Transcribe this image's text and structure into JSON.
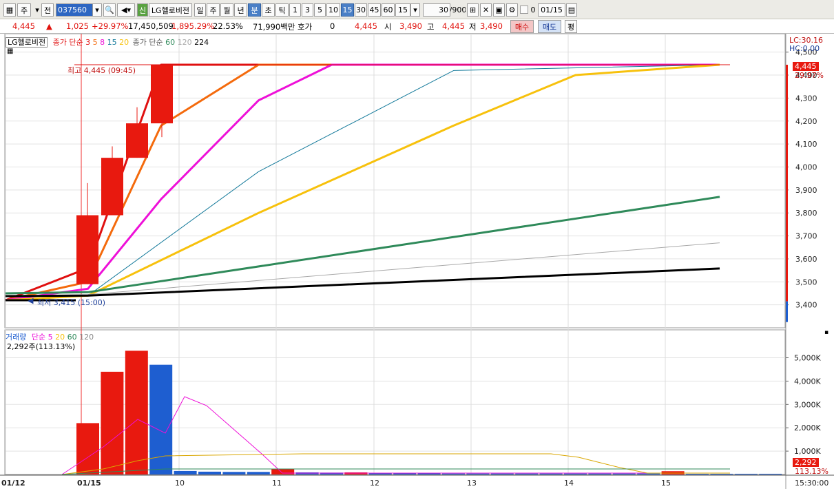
{
  "toolbar": {
    "chart_type_label": "주",
    "all_label": "전",
    "code_value": "037560",
    "new_label": "신",
    "stock_name": "LG헬로비전",
    "period_tabs": [
      "일",
      "주",
      "월",
      "년",
      "분",
      "초",
      "틱"
    ],
    "active_period": "분",
    "interval_buttons": [
      "1",
      "3",
      "5",
      "10",
      "15",
      "30",
      "45",
      "60"
    ],
    "active_interval": "15",
    "interval_select": "15",
    "count_value": "30",
    "count_total": "/900",
    "checkbox_label": "0",
    "date_value": "01/15"
  },
  "quote": {
    "price": "4,445",
    "change": "1,025",
    "change_pct": "+29.97%",
    "volume": "17,450,509",
    "volume_pct": "1,895.29%",
    "turnover_pct": "22.53%",
    "amount": "71,990백만",
    "hoga_label": "호가",
    "hoga_value": "0",
    "ask": "4,445",
    "open_label": "시",
    "open": "3,490",
    "high_label": "고",
    "high": "4,445",
    "low_label": "저",
    "low": "3,490",
    "buy_button": "매수",
    "sell_button": "매도",
    "eval_button": "평"
  },
  "price_legend": {
    "name": "LG헬로비전",
    "ma_label": "종가 단순",
    "ma_periods": [
      "3",
      "5",
      "8",
      "15",
      "20"
    ],
    "ma2_label": "종가 단순",
    "ma2_periods": [
      "60",
      "120",
      "224"
    ]
  },
  "volume_legend": {
    "label": "거래량",
    "ma_label": "단순",
    "ma_periods": [
      "5",
      "20",
      "60",
      "120"
    ],
    "current": "2,292주(113.13%)"
  },
  "annotations": {
    "high": "최고 4,445 (09:45)",
    "low": "최저 3,415 (15:00)",
    "lc": "LC:30.16",
    "hc": "HC:0.00",
    "price_tag": "4,445",
    "price_tag_pct": "29.97%",
    "vol_tag": "2,292",
    "vol_tag_pct": "113.13%"
  },
  "colors": {
    "up": "#e8190f",
    "down": "#1e5ed0",
    "ma3": "#e01010",
    "ma5": "#f46a0c",
    "ma8": "#ee10d8",
    "ma15": "#12799a",
    "ma20": "#f7c10c",
    "ma60": "#2f8a5a",
    "ma120": "#a9a9a9",
    "ma224": "#000000"
  },
  "chart_data": [
    {
      "type": "candlestick",
      "title": "LG헬로비전",
      "x": [
        "01/12 15:00",
        "01/15 09:00",
        "01/15 09:15",
        "01/15 09:30",
        "01/15 09:45"
      ],
      "ohlc": [
        [
          3415,
          3420,
          3415,
          3420
        ],
        [
          3490,
          3930,
          3490,
          3790
        ],
        [
          3790,
          4090,
          3790,
          4040
        ],
        [
          4040,
          4260,
          4040,
          4190
        ],
        [
          4190,
          4445,
          4130,
          4445
        ]
      ],
      "ylim": [
        3330,
        4550
      ],
      "y_ticks": [
        "3,400",
        "3,500",
        "3,600",
        "3,700",
        "3,800",
        "3,900",
        "4,000",
        "4,100",
        "4,200",
        "4,300",
        "4,400",
        "4,500"
      ],
      "x_ticks": [
        "01/12",
        "01/15",
        "10",
        "11",
        "12",
        "13",
        "14",
        "15",
        "15:30:00"
      ],
      "series": [
        {
          "name": "3",
          "endpoints": [
            [
              0,
              3420
            ],
            [
              1,
              3560
            ],
            [
              4,
              4445
            ],
            [
              6,
              4445
            ],
            [
              30,
              4445
            ]
          ]
        },
        {
          "name": "5",
          "endpoints": [
            [
              0,
              3420
            ],
            [
              1,
              3500
            ],
            [
              4,
              4180
            ],
            [
              8,
              4445
            ],
            [
              30,
              4445
            ]
          ]
        },
        {
          "name": "8",
          "endpoints": [
            [
              0,
              3420
            ],
            [
              1,
              3470
            ],
            [
              4,
              3860
            ],
            [
              8,
              4290
            ],
            [
              11,
              4445
            ],
            [
              30,
              4445
            ]
          ]
        },
        {
          "name": "15",
          "endpoints": [
            [
              0,
              3420
            ],
            [
              1,
              3440
            ],
            [
              8,
              3980
            ],
            [
              16,
              4420
            ],
            [
              30,
              4445
            ]
          ]
        },
        {
          "name": "20",
          "endpoints": [
            [
              0,
              3420
            ],
            [
              1,
              3440
            ],
            [
              8,
              3800
            ],
            [
              16,
              4180
            ],
            [
              21,
              4400
            ],
            [
              30,
              4445
            ]
          ]
        },
        {
          "name": "60",
          "endpoints": [
            [
              0,
              3450
            ],
            [
              1,
              3455
            ],
            [
              30,
              3870
            ]
          ]
        },
        {
          "name": "120",
          "endpoints": [
            [
              0,
              3440
            ],
            [
              1,
              3445
            ],
            [
              30,
              3670
            ]
          ]
        },
        {
          "name": "224",
          "endpoints": [
            [
              0,
              3438
            ],
            [
              1,
              3440
            ],
            [
              30,
              3558
            ]
          ]
        }
      ]
    },
    {
      "type": "bar",
      "title": "거래량",
      "values_k": [
        0,
        2200,
        4400,
        5300,
        4700,
        150,
        120,
        110,
        110,
        250,
        90,
        80,
        90,
        60,
        50,
        50,
        40,
        40,
        40,
        40,
        40,
        40,
        40,
        40,
        40,
        140,
        30,
        30,
        30,
        30
      ],
      "ylim": [
        0,
        5900
      ],
      "y_ticks": [
        "1,000K",
        "2,000K",
        "3,000K",
        "4,000K",
        "5,000K"
      ]
    }
  ]
}
